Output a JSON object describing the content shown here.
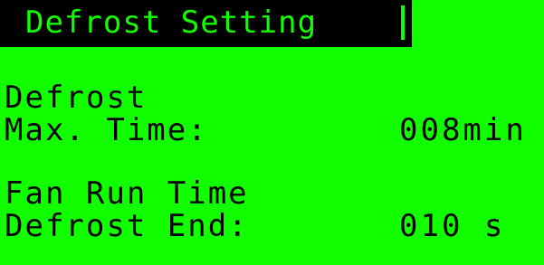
{
  "header": {
    "title": "Defrost Setting"
  },
  "settings": [
    {
      "label_line1": "Defrost",
      "label_line2": "Max. Time:",
      "value": "008min"
    },
    {
      "label_line1": "Fan Run Time",
      "label_line2": "Defrost End:",
      "value": "010 s"
    }
  ],
  "colors": {
    "background": "#12ff00",
    "text": "#000000",
    "title_bar": "#000000"
  }
}
